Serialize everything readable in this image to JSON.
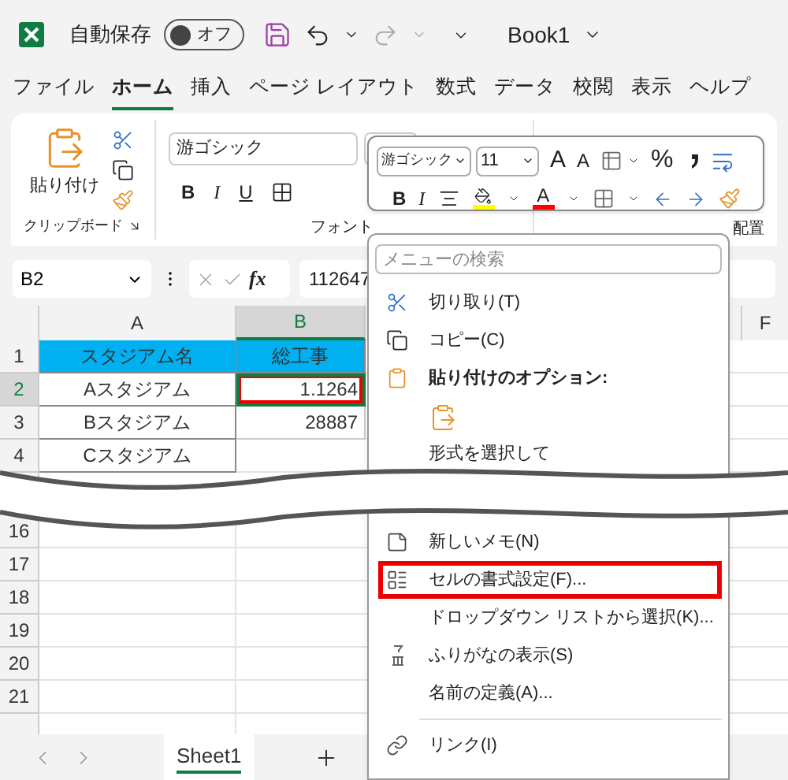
{
  "title_bar": {
    "autosave": {
      "label": "自動保存",
      "on": false,
      "state_text": "オフ"
    },
    "document": "Book1"
  },
  "ribbon_tabs": [
    {
      "label": "ファイル",
      "selected": false
    },
    {
      "label": "ホーム",
      "selected": true
    },
    {
      "label": "挿入",
      "selected": false
    },
    {
      "label": "ページ レイアウト",
      "selected": false
    },
    {
      "label": "数式",
      "selected": false
    },
    {
      "label": "データ",
      "selected": false
    },
    {
      "label": "校閲",
      "selected": false
    },
    {
      "label": "表示",
      "selected": false
    },
    {
      "label": "ヘルプ",
      "selected": false
    }
  ],
  "ribbon": {
    "clipboard": {
      "paste_label": "貼り付け",
      "group_label": "クリップボード"
    },
    "font": {
      "font_name": "游ゴシック",
      "bold": "B",
      "italic": "I",
      "underline": "U",
      "group_label": "フォント"
    },
    "alignment": {
      "group_label": "配置"
    }
  },
  "mini_toolbar": {
    "font_name": "游ゴシック",
    "font_size": "11",
    "grow_font": "A",
    "shrink_font": "A",
    "percent": "%",
    "bold": "B",
    "italic": "I",
    "font_color_glyph": "A"
  },
  "formula_bar": {
    "name_box": "B2",
    "fx": "fx",
    "formula": "112647"
  },
  "sheet": {
    "columns": [
      {
        "label": "A",
        "selected": false
      },
      {
        "label": "B",
        "selected": true
      },
      {
        "label": "F",
        "selected": false
      }
    ],
    "rows": [
      {
        "header": "1",
        "selected": false,
        "cells": [
          {
            "text": "スタジアム名",
            "kind": "header",
            "selected": false,
            "highlighted": false
          },
          {
            "text": "総工事",
            "kind": "header",
            "selected": false,
            "highlighted": false
          }
        ]
      },
      {
        "header": "2",
        "selected": true,
        "cells": [
          {
            "text": "Aスタジアム",
            "kind": "text",
            "selected": false,
            "highlighted": false
          },
          {
            "text": "1.1264",
            "kind": "number",
            "selected": true,
            "highlighted": true
          }
        ]
      },
      {
        "header": "3",
        "selected": false,
        "cells": [
          {
            "text": "Bスタジアム",
            "kind": "text",
            "selected": false,
            "highlighted": false
          },
          {
            "text": "28887",
            "kind": "number",
            "selected": false,
            "highlighted": false
          }
        ]
      },
      {
        "header": "4",
        "selected": false,
        "cells": [
          {
            "text": "Cスタジアム",
            "kind": "text",
            "selected": false,
            "highlighted": false
          }
        ]
      }
    ],
    "rows_after_break": [
      {
        "header": "16"
      },
      {
        "header": "17"
      },
      {
        "header": "18"
      },
      {
        "header": "19"
      },
      {
        "header": "20"
      },
      {
        "header": "21"
      }
    ]
  },
  "context_menu": {
    "search_placeholder": "メニューの検索",
    "items": [
      {
        "kind": "cut",
        "label": "切り取り(T)",
        "highlighted": false
      },
      {
        "kind": "copy",
        "label": "コピー(C)",
        "highlighted": false
      },
      {
        "kind": "heading",
        "label": "貼り付けのオプション:",
        "highlighted": false
      },
      {
        "kind": "paste",
        "highlighted": false
      },
      {
        "kind": "cutoff",
        "label": "形式を選択して",
        "highlighted": false
      },
      {
        "kind": "note",
        "label": "新しいメモ(N)",
        "highlighted": false
      },
      {
        "kind": "format",
        "label": "セルの書式設定(F)...",
        "highlighted": true
      },
      {
        "kind": "command",
        "label": "ドロップダウン リストから選択(K)...",
        "highlighted": false
      },
      {
        "kind": "furigana",
        "label": "ふりがなの表示(S)",
        "highlighted": false
      },
      {
        "kind": "command",
        "label": "名前の定義(A)...",
        "highlighted": false
      },
      {
        "kind": "separator"
      },
      {
        "kind": "link",
        "label": "リンク(I)",
        "highlighted": false
      }
    ]
  },
  "sheet_tabs": [
    {
      "label": "Sheet1",
      "selected": true
    }
  ]
}
